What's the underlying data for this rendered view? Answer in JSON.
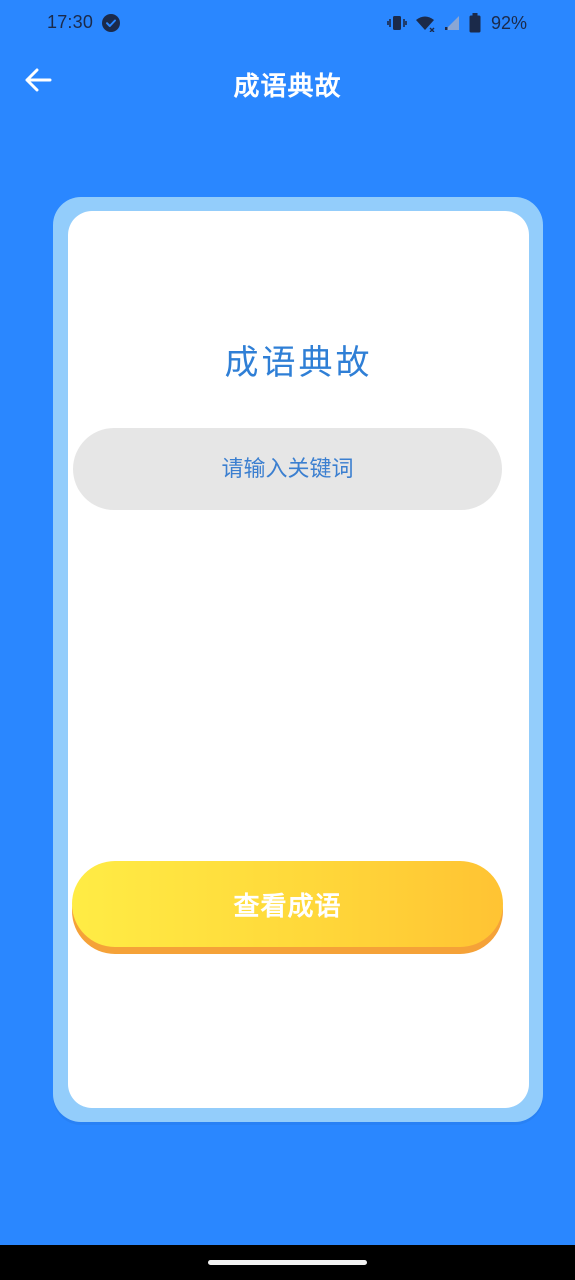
{
  "status_bar": {
    "time": "17:30",
    "battery_percent": "92%",
    "icons": [
      "check-circle-icon",
      "vibrate-icon",
      "wifi-icon",
      "signal-icon",
      "battery-icon"
    ]
  },
  "app_bar": {
    "title": "成语典故",
    "back_icon": "arrow-left-icon"
  },
  "card": {
    "title": "成语典故",
    "search_placeholder": "请输入关键词",
    "search_value": "",
    "submit_label": "查看成语"
  },
  "colors": {
    "background": "#2a87ff",
    "card_border": "#93cdfb",
    "title_text": "#2f7fd6",
    "button_gradient_start": "#ffec45",
    "button_gradient_end": "#ffc333",
    "button_shadow": "#f5a238"
  }
}
